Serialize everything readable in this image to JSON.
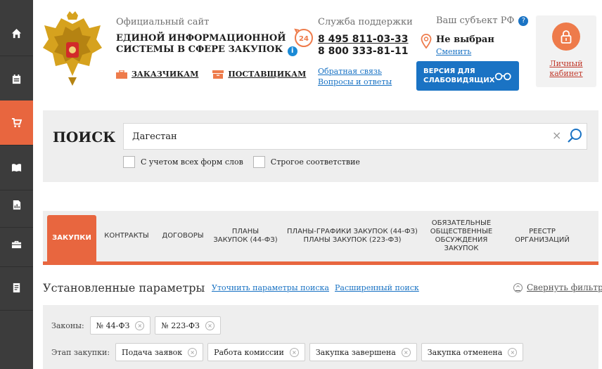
{
  "sidebar": {
    "items": [
      {
        "icon": "home-icon"
      },
      {
        "icon": "calendar-icon"
      },
      {
        "icon": "cart-icon",
        "active": true
      },
      {
        "icon": "book-icon"
      },
      {
        "icon": "report-icon"
      },
      {
        "icon": "briefcase-icon"
      },
      {
        "icon": "document-icon"
      }
    ]
  },
  "header": {
    "official_label": "Официальный сайт",
    "site_title_line1": "ЕДИНОЙ ИНФОРМАЦИОННОЙ",
    "site_title_line2": "СИСТЕМЫ В СФЕРЕ ЗАКУПОК",
    "info_glyph": "i",
    "customers_link": "ЗАКАЗЧИКАМ",
    "suppliers_link": "ПОСТАВЩИКАМ",
    "support_label": "Служба поддержки",
    "support_badge": "24",
    "phone1": "8 495 811-03-33",
    "phone2": "8 800 333-81-11",
    "feedback_link": "Обратная связь",
    "faq_link": "Вопросы и ответы",
    "region_label": "Ваш субъект РФ",
    "region_help_glyph": "?",
    "region_value": "Не выбран",
    "region_change": "Сменить",
    "vision_line1": "ВЕРСИЯ ДЛЯ",
    "vision_line2": "СЛАБОВИДЯЩИХ",
    "cabinet_line1": "Личный",
    "cabinet_line2": "кабинет"
  },
  "search": {
    "title": "ПОИСК",
    "value": "Дагестан",
    "clear_glyph": "×",
    "all_word_forms": "С учетом всех форм слов",
    "strict_match": "Строгое соответствие"
  },
  "tabs": [
    {
      "label": "ЗАКУПКИ",
      "active": true
    },
    {
      "label": "КОНТРАКТЫ"
    },
    {
      "label": "ДОГОВОРЫ"
    },
    {
      "label": "ПЛАНЫ\nЗАКУПОК (44-ФЗ)"
    },
    {
      "label": "ПЛАНЫ-ГРАФИКИ ЗАКУПОК (44-ФЗ)\nПЛАНЫ ЗАКУПОК (223-ФЗ)"
    },
    {
      "label": "ОБЯЗАТЕЛЬНЫЕ\nОБЩЕСТВЕННЫЕ\nОБСУЖДЕНИЯ\nЗАКУПОК"
    },
    {
      "label": "РЕЕСТР\nОРГАНИЗАЦИЙ"
    }
  ],
  "params": {
    "title": "Установленные параметры",
    "refine_link": "Уточнить параметры поиска",
    "advanced_link": "Расширенный поиск",
    "collapse_label": "Свернуть фильтр",
    "collapse_glyph": "^",
    "remove_glyph": "×",
    "laws_label": "Законы:",
    "laws": [
      "№ 44-ФЗ",
      "№ 223-ФЗ"
    ],
    "stage_label": "Этап закупки:",
    "stages": [
      "Подача заявок",
      "Работа комиссии",
      "Закупка завершена",
      "Закупка отменена"
    ]
  },
  "colors": {
    "accent": "#e8663f",
    "link": "#1a73c4",
    "sidebar": "#3c3c3c"
  }
}
